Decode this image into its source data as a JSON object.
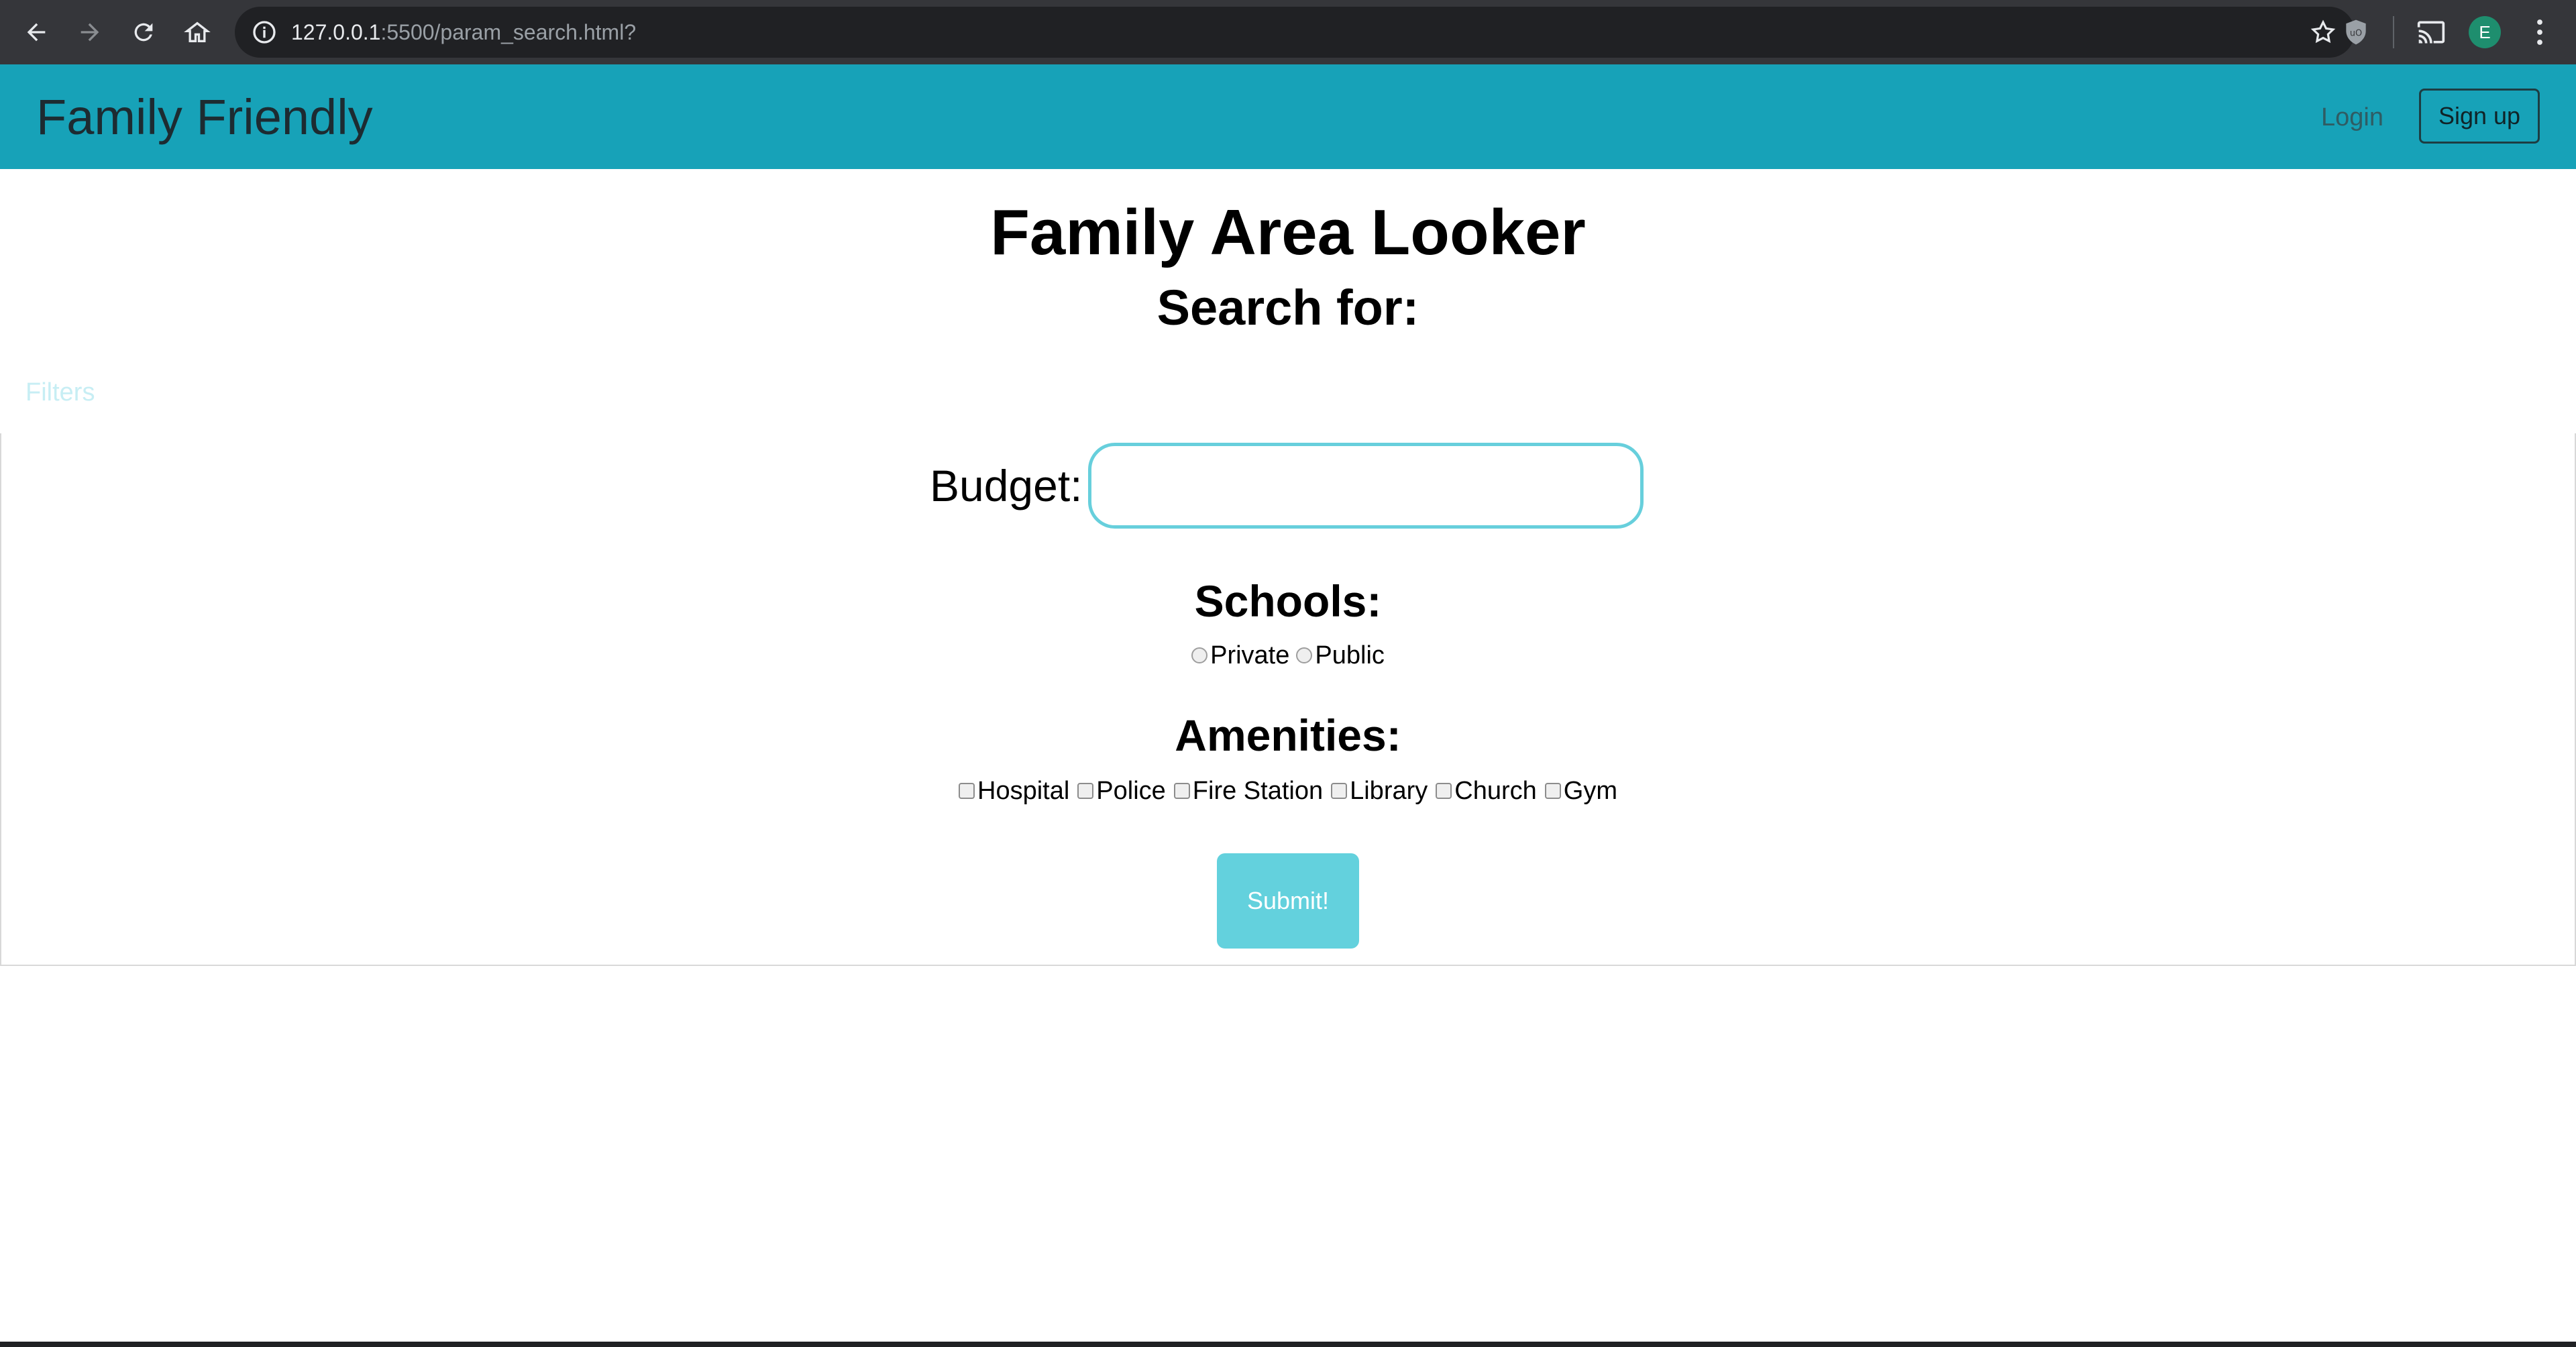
{
  "browser": {
    "url_host": "127.0.0.1",
    "url_rest": ":5500/param_search.html?",
    "profile_initial": "E"
  },
  "navbar": {
    "brand": "Family Friendly",
    "login_label": "Login",
    "signup_label": "Sign up",
    "color": "#17a2b8"
  },
  "main": {
    "title": "Family Area Looker",
    "subtitle": "Search for:",
    "filters_label": "Filters",
    "budget": {
      "label": "Budget:",
      "value": "",
      "placeholder": ""
    },
    "schools": {
      "heading": "Schools:",
      "options": [
        "Private",
        "Public"
      ]
    },
    "amenities": {
      "heading": "Amenities:",
      "options": [
        "Hospital",
        "Police",
        "Fire Station",
        "Library",
        "Church",
        "Gym"
      ]
    },
    "submit_label": "Submit!"
  }
}
